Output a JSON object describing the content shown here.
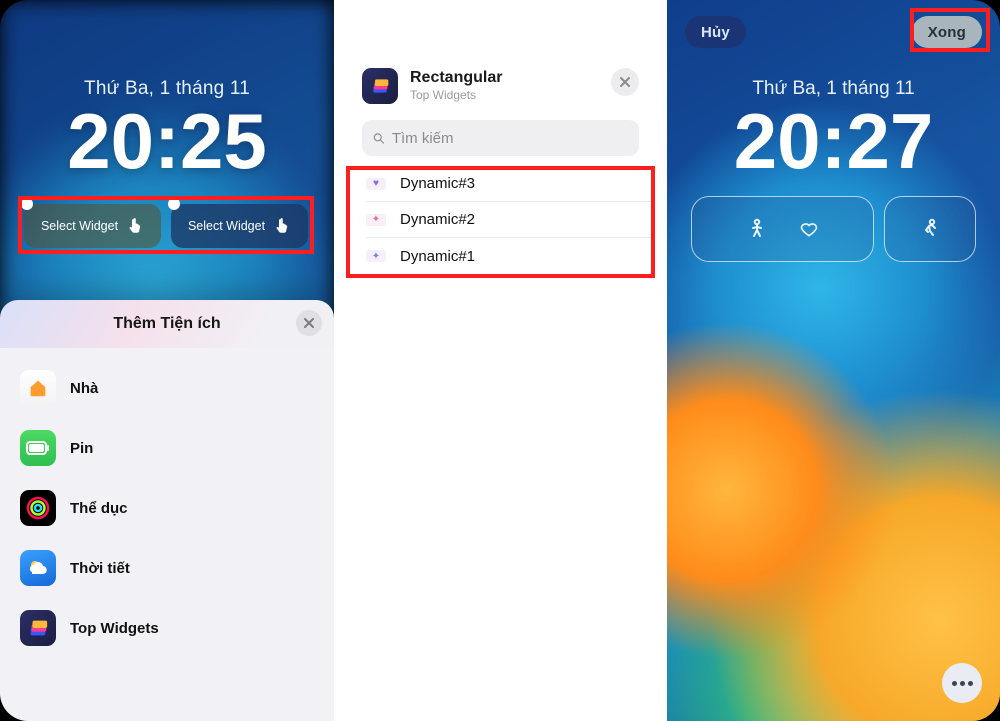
{
  "phone1": {
    "date": "Thứ Ba, 1 tháng 11",
    "time": "20:25",
    "select_widget_label": "Select Widget",
    "sheet": {
      "title": "Thêm Tiện ích",
      "items": [
        {
          "label": "Nhà"
        },
        {
          "label": "Pin"
        },
        {
          "label": "Thể dục"
        },
        {
          "label": "Thời tiết"
        },
        {
          "label": "Top Widgets"
        }
      ]
    }
  },
  "phone2": {
    "title": "Rectangular",
    "subtitle": "Top Widgets",
    "search_placeholder": "Tìm kiếm",
    "rows": [
      {
        "label": "Dynamic#3"
      },
      {
        "label": "Dynamic#2"
      },
      {
        "label": "Dynamic#1"
      }
    ]
  },
  "phone3": {
    "cancel": "Hủy",
    "done": "Xong",
    "date": "Thứ Ba, 1 tháng 11",
    "time": "20:27"
  },
  "colors": {
    "highlight": "#ff1e1e"
  }
}
